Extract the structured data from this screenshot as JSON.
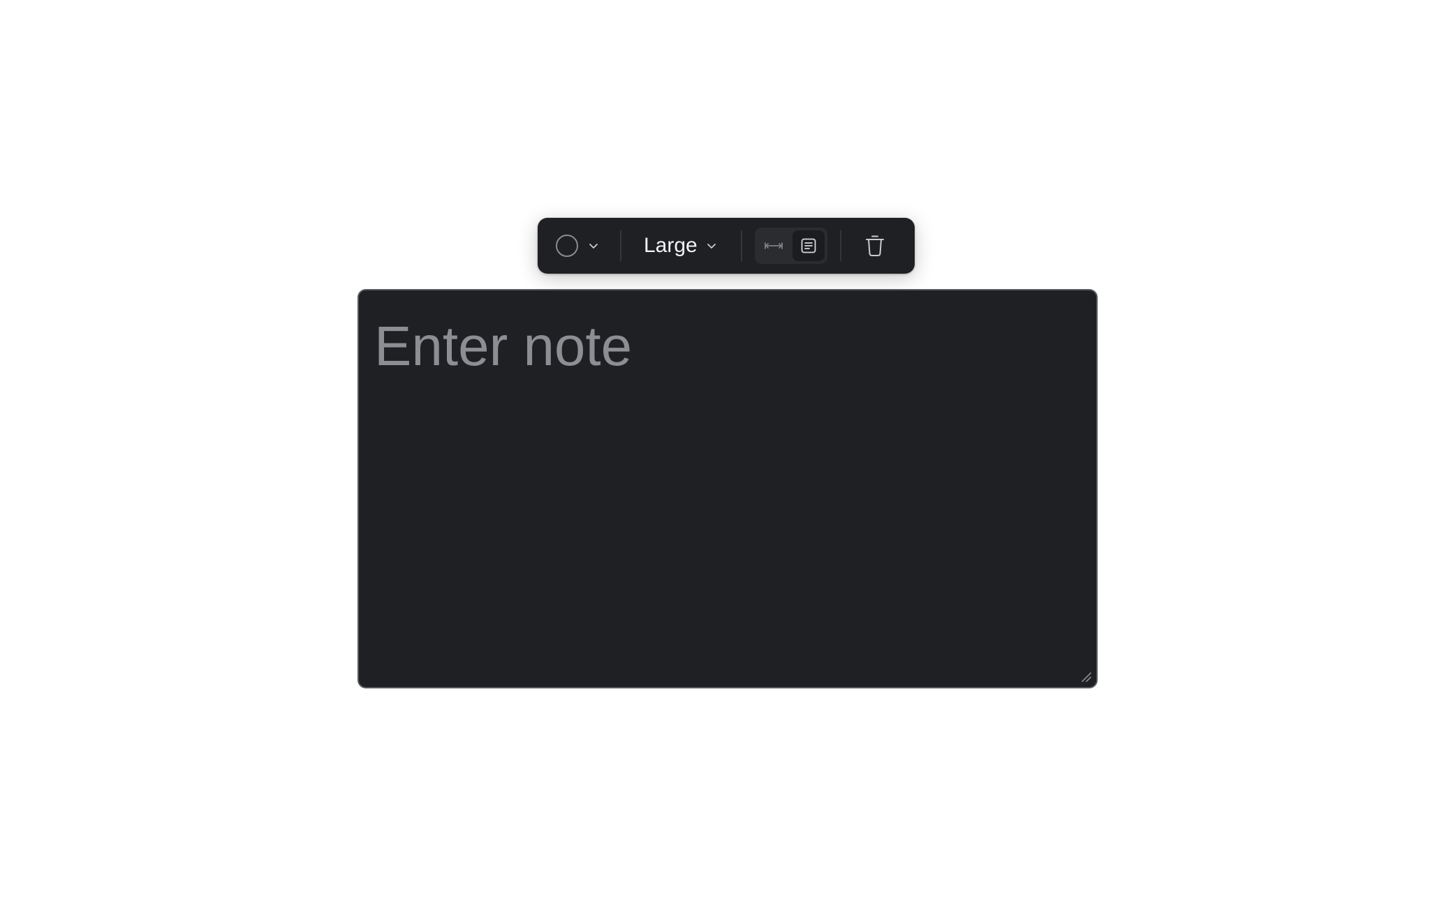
{
  "toolbar": {
    "color_picker": {
      "swatch_color": "transparent",
      "icon": "chevron-down-icon"
    },
    "size_select": {
      "selected": "Large",
      "icon": "chevron-down-icon"
    },
    "mode_toggle": {
      "options": [
        {
          "icon": "arrow-left-right-icon",
          "active": false
        },
        {
          "icon": "text-block-icon",
          "active": true
        }
      ]
    },
    "delete": {
      "icon": "trash-icon"
    }
  },
  "note": {
    "value": "",
    "placeholder": "Enter note"
  },
  "colors": {
    "panel_bg": "#1f2023",
    "panel_border": "#56595e",
    "text_primary": "#f1f2f4",
    "text_placeholder": "#8c8e93",
    "icon_muted": "#8b8d92",
    "toggle_bg": "#2a2c30"
  }
}
